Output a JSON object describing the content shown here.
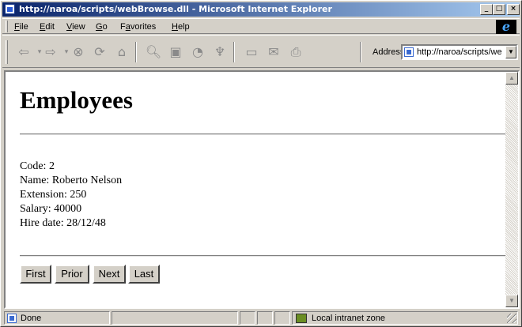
{
  "window": {
    "title": "http://naroa/scripts/webBrowse.dll - Microsoft Internet Explorer"
  },
  "menu": [
    {
      "label": "File",
      "key": "F",
      "rest": "ile"
    },
    {
      "label": "Edit",
      "key": "E",
      "rest": "dit"
    },
    {
      "label": "View",
      "key": "V",
      "rest": "iew"
    },
    {
      "label": "Go",
      "key": "G",
      "rest": "o"
    },
    {
      "label": "Favorites",
      "key": "a",
      "pre": "F",
      "rest": "vorites"
    },
    {
      "label": "Help",
      "key": "H",
      "rest": "elp"
    }
  ],
  "toolbar": {
    "icons": [
      "back-icon",
      "forward-icon",
      "stop-icon",
      "refresh-icon",
      "home-icon",
      "search-icon",
      "favorites-icon",
      "history-icon",
      "channels-icon",
      "fullscreen-icon",
      "mail-icon",
      "print-icon"
    ],
    "address_label": "Address",
    "address_value": "http://naroa/scripts/we"
  },
  "page": {
    "title": "Employees",
    "fields": [
      "Code: 2",
      "Name: Roberto Nelson",
      "Extension: 250",
      "Salary: 40000",
      "Hire date: 28/12/48"
    ],
    "buttons": [
      "First",
      "Prior",
      "Next",
      "Last"
    ]
  },
  "status": {
    "text": "Done",
    "zone": "Local intranet zone"
  },
  "colors": {
    "titlebar_start": "#0a246a",
    "titlebar_end": "#a6caf0",
    "chrome": "#d4d0c8"
  }
}
